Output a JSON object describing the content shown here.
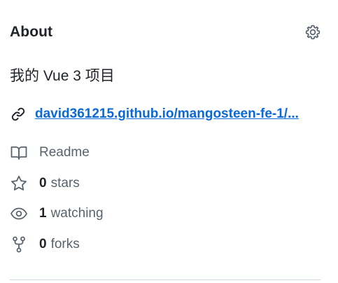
{
  "about": {
    "heading": "About",
    "settings_icon": "gear-icon",
    "description": "我的 Vue 3 项目",
    "homepage": {
      "icon": "link-icon",
      "text": "david361215.github.io/mangosteen-fe-1/..."
    },
    "readme": {
      "icon": "book-icon",
      "label": "Readme"
    },
    "stars": {
      "icon": "star-icon",
      "count": "0",
      "label": "stars"
    },
    "watching": {
      "icon": "eye-icon",
      "count": "1",
      "label": "watching"
    },
    "forks": {
      "icon": "repo-forked-icon",
      "count": "0",
      "label": "forks"
    }
  },
  "colors": {
    "text": "#1f2328",
    "muted": "#59636e",
    "link": "#0969da",
    "divider": "#d1d9e0"
  }
}
